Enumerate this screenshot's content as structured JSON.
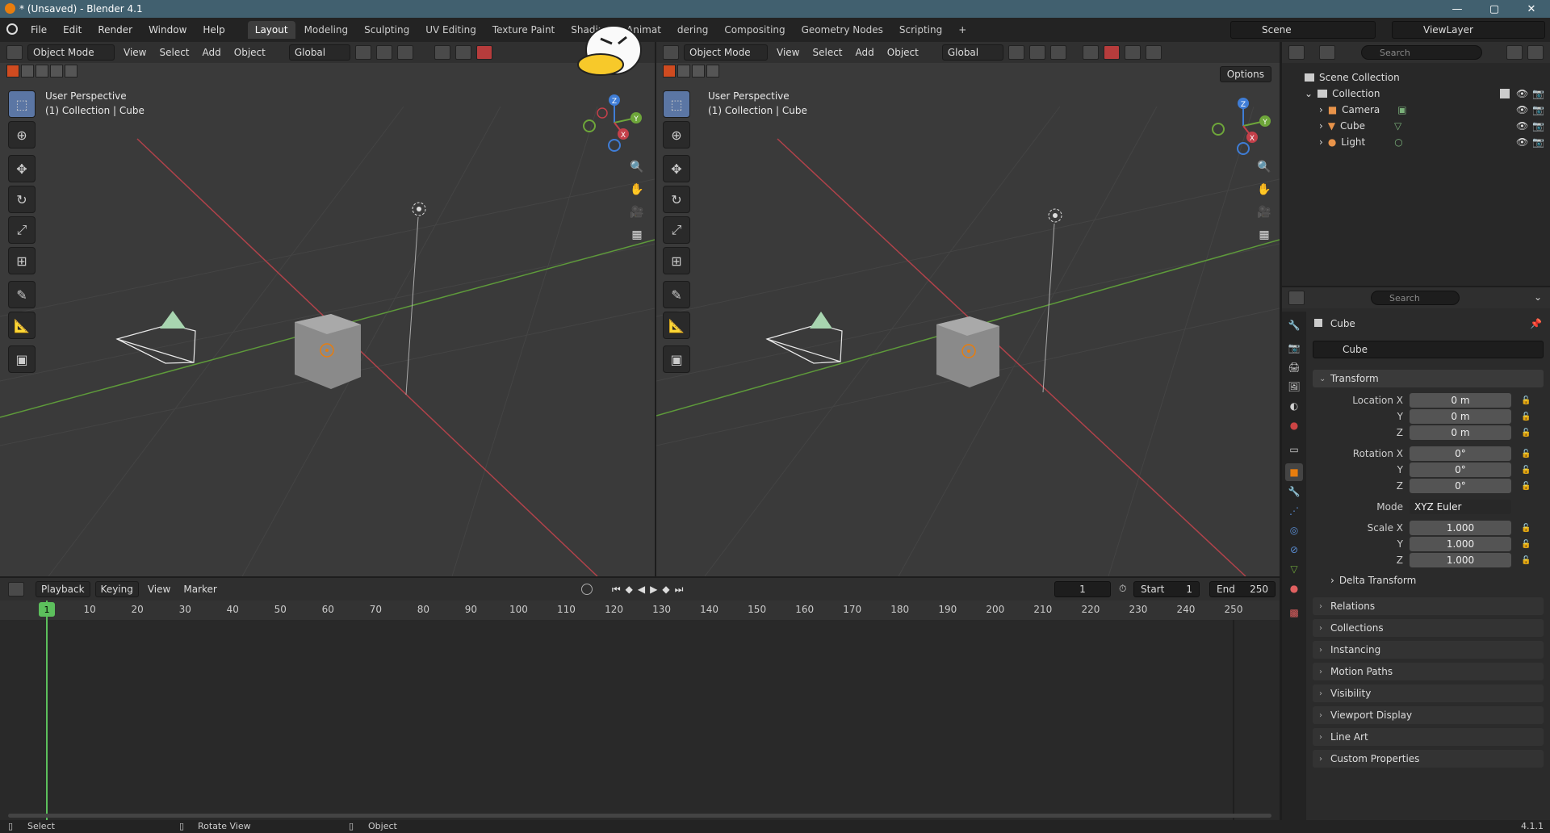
{
  "window": {
    "title": "* (Unsaved) - Blender 4.1",
    "controls": [
      "—",
      "▢",
      "✕"
    ]
  },
  "menu": [
    "File",
    "Edit",
    "Render",
    "Window",
    "Help"
  ],
  "workspaces": [
    "Layout",
    "Modeling",
    "Sculpting",
    "UV Editing",
    "Texture Paint",
    "Shading",
    "Animat",
    "dering",
    "Compositing",
    "Geometry Nodes",
    "Scripting",
    "+"
  ],
  "scene": {
    "scene_name": "Scene",
    "view_layer": "ViewLayer"
  },
  "viewport_left": {
    "mode": "Object Mode",
    "menus": [
      "View",
      "Select",
      "Add",
      "Object"
    ],
    "orientation": "Global",
    "info_line1": "User Perspective",
    "info_line2": "(1) Collection | Cube",
    "options": "Options"
  },
  "viewport_right": {
    "mode": "Object Mode",
    "menus": [
      "View",
      "Select",
      "Add",
      "Object"
    ],
    "orientation": "Global",
    "info_line1": "User Perspective",
    "info_line2": "(1) Collection | Cube"
  },
  "gizmo": {
    "x": "X",
    "y": "Y",
    "z": "Z"
  },
  "colors": {
    "x_axis": "#c4404a",
    "y_axis": "#6ea63a",
    "z_axis": "#3f7dd6",
    "active": "#e87d0d",
    "select": "#5b76a4"
  },
  "timeline": {
    "menus": [
      "Playback",
      "Keying",
      "View",
      "Marker"
    ],
    "current_frame": "1",
    "start_label": "Start",
    "start": "1",
    "end_label": "End",
    "end": "250",
    "ruler": [
      "1",
      "10",
      "20",
      "30",
      "40",
      "50",
      "60",
      "70",
      "80",
      "90",
      "100",
      "110",
      "120",
      "130",
      "140",
      "150",
      "160",
      "170",
      "180",
      "190",
      "200",
      "210",
      "220",
      "230",
      "240",
      "250"
    ]
  },
  "outliner": {
    "search_placeholder": "Search",
    "root": "Scene Collection",
    "collection": "Collection",
    "items": [
      "Camera",
      "Cube",
      "Light"
    ]
  },
  "properties": {
    "search_placeholder": "Search",
    "object_name": "Cube",
    "object_field": "Cube",
    "transform_title": "Transform",
    "location_label": "Location X",
    "y_label": "Y",
    "z_label": "Z",
    "location": [
      "0 m",
      "0 m",
      "0 m"
    ],
    "rotation_label": "Rotation X",
    "rotation": [
      "0°",
      "0°",
      "0°"
    ],
    "mode_label": "Mode",
    "mode_value": "XYZ Euler",
    "scale_label": "Scale X",
    "scale": [
      "1.000",
      "1.000",
      "1.000"
    ],
    "delta": "Delta Transform",
    "panels": [
      "Relations",
      "Collections",
      "Instancing",
      "Motion Paths",
      "Visibility",
      "Viewport Display",
      "Line Art",
      "Custom Properties"
    ]
  },
  "status": {
    "select": "Select",
    "rotate": "Rotate View",
    "object": "Object",
    "version": "4.1.1"
  }
}
